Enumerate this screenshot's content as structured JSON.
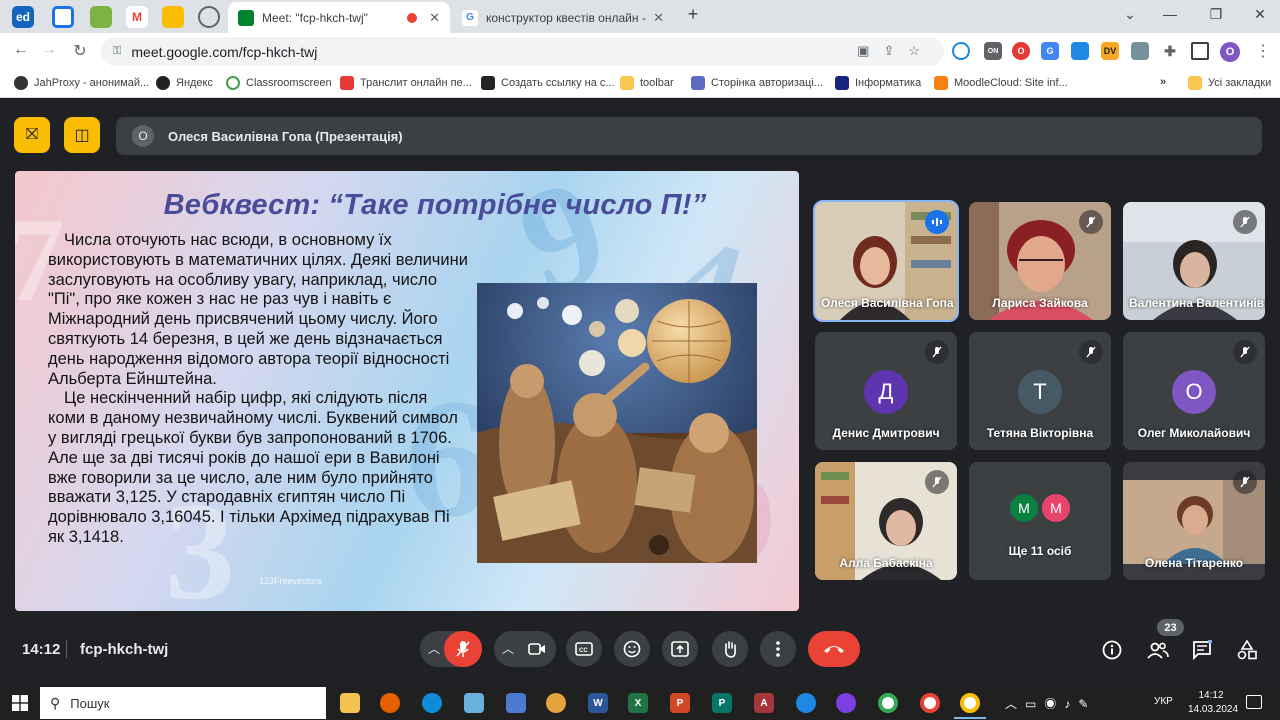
{
  "browser": {
    "tabs": [
      {
        "title": "Meet: \"fcp-hkch-twj\"",
        "active": true
      },
      {
        "title": "конструктор квестів онлайн - Пош",
        "active": false
      }
    ],
    "url": "meet.google.com/fcp-hkch-twj",
    "bookmarks": [
      "JahProxy - анонимай...",
      "Яндекс",
      "Classroomscreen",
      "Транслит онлайн пе...",
      "Создать ссылку на с...",
      "toolbar",
      "Сторінка авторизаці...",
      "Інформатика",
      "MoodleCloud: Site inf..."
    ],
    "all_bookmarks": "Усі закладки",
    "profile_initial": "О",
    "ext_labels": {
      "dv": "DV",
      "on": "ON"
    },
    "pinned": {
      "first": "ed"
    }
  },
  "meet": {
    "presenter_initial": "О",
    "presenter_label": "Олеся Василівна Гопа (Презентація)",
    "slide": {
      "title": "Вебквест: “Таке потрібне число П!”",
      "paragraph1": "Числа оточують нас всюди, в основному їх використовують в математичних цілях. Деякі величини заслуговують на особливу увагу, наприклад, число \"Пі\", про яке кожен з нас не раз чув і навіть є Міжнародний день присвячений цьому числу. Його святкують 14 березня, в цей же день відзначається день народження відомого автора теорії відносності Альберта Ейнштейна.",
      "paragraph2": "Це нескінченний набір цифр, які слідують після коми в даному незвичайному числі. Буквений символ у вигляді грецької букви був запропонований в 1706. Але ще за дві тисячі років до нашої ери в Вавилоні вже говорили за це число, але ним було прийнято вважати 3,125. У стародавніх єгиптян число Пі дорівнювало 3,16045. І тільки Архімед підрахував Пі як 3,1418.",
      "watermark": "123Freevectors"
    },
    "participants": [
      {
        "name": "Олеся Василівна Гопа",
        "type": "video",
        "speaking": true
      },
      {
        "name": "Лариса Зайкова",
        "type": "video"
      },
      {
        "name": "Валентина Валентинівна",
        "type": "video"
      },
      {
        "name": "Денис Дмитрович",
        "type": "avatar",
        "initial": "Д",
        "color": "#5e35b1"
      },
      {
        "name": "Тетяна Вікторівна",
        "type": "avatar",
        "initial": "Т",
        "color": "#455a64"
      },
      {
        "name": "Олег Миколайович",
        "type": "avatar",
        "initial": "О",
        "color": "#7e57c2"
      },
      {
        "name": "Алла Бабаскіна",
        "type": "video"
      },
      {
        "name": "Олена Тітаренко",
        "type": "video"
      }
    ],
    "others": {
      "label": "Ще 11 осіб",
      "initials": [
        "М",
        "М"
      ],
      "colors": [
        "#0b8043",
        "#e8436a"
      ]
    },
    "time": "14:12",
    "meeting_code": "fcp-hkch-twj",
    "participants_count": "23"
  },
  "taskbar": {
    "search_placeholder": "Пошук",
    "language": "УКР",
    "time": "14:12",
    "date": "14.03.2024"
  }
}
